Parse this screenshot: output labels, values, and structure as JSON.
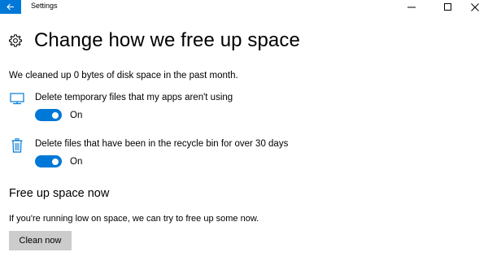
{
  "window": {
    "title": "Settings",
    "controls": {
      "minimize": "minimize-icon",
      "maximize": "maximize-icon",
      "close": "close-icon"
    },
    "back_icon": "back-arrow-icon"
  },
  "header": {
    "icon": "gear-icon",
    "title": "Change how we free up space"
  },
  "summary": "We cleaned up 0 bytes of disk space in the past month.",
  "settings": [
    {
      "icon": "monitor-icon",
      "label": "Delete temporary files that my apps aren't using",
      "toggle_state": "On",
      "enabled": true
    },
    {
      "icon": "recycle-bin-icon",
      "label": "Delete files that have been in the recycle bin for over 30 days",
      "toggle_state": "On",
      "enabled": true
    }
  ],
  "free_up": {
    "title": "Free up space now",
    "description": "If you're running low on space, we can try to free up some now.",
    "button_label": "Clean now"
  },
  "colors": {
    "accent": "#0078d7",
    "button_bg": "#cccccc",
    "background": "#ffffff"
  }
}
